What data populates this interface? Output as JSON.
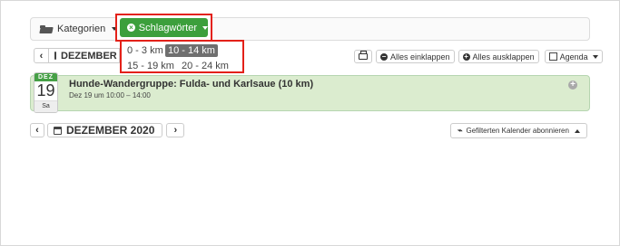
{
  "filter": {
    "categories_label": "Kategorien",
    "tags_label": "Schlagwörter",
    "tag_options": [
      {
        "label": "0 - 3 km",
        "active": false
      },
      {
        "label": "10 - 14 km",
        "active": true
      },
      {
        "label": "15 - 19 km",
        "active": false
      },
      {
        "label": "20 - 24 km",
        "active": false
      }
    ]
  },
  "nav_top": {
    "prev": "‹",
    "month_label": "DEZEMBER"
  },
  "toolbar": {
    "collapse_all": "Alles einklappen",
    "expand_all": "Alles ausklappen",
    "view_label": "Agenda"
  },
  "event": {
    "month": "DEZ",
    "day": "19",
    "weekday": "Sa",
    "title": "Hunde-Wandergruppe: Fulda- und Karlsaue (10 km)",
    "time": "Dez 19 um 10:00 – 14:00"
  },
  "nav_bottom": {
    "prev": "‹",
    "month_label": "DEZEMBER 2020",
    "next": "›"
  },
  "subscribe_label": "Gefilterten Kalender abonnieren",
  "colors": {
    "tag_button": "#3c9f3c",
    "highlight_border": "#e32119",
    "event_bg": "#dbeccf"
  }
}
